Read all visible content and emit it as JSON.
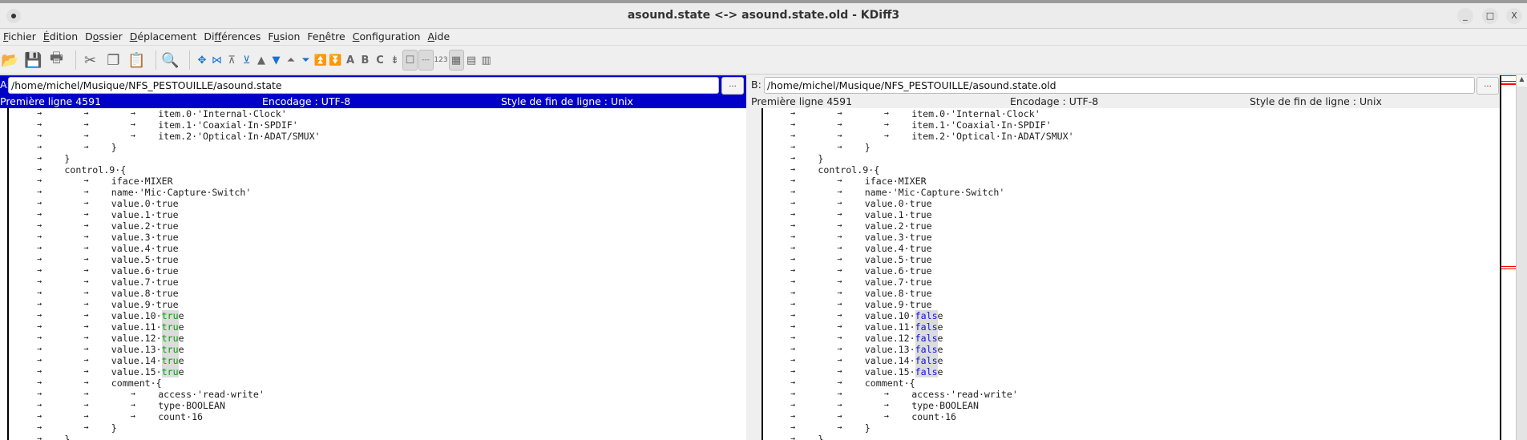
{
  "window": {
    "title": "asound.state <-> asound.state.old - KDiff3",
    "minimize": "_",
    "maximize": "□",
    "close": "X"
  },
  "menu": [
    {
      "pre": "",
      "key": "F",
      "post": "ichier"
    },
    {
      "pre": "",
      "key": "É",
      "post": "dition"
    },
    {
      "pre": "D",
      "key": "o",
      "post": "ssier"
    },
    {
      "pre": "",
      "key": "D",
      "post": "éplacement"
    },
    {
      "pre": "Di",
      "key": "f",
      "post": "férences"
    },
    {
      "pre": "F",
      "key": "u",
      "post": "sion"
    },
    {
      "pre": "Fe",
      "key": "n",
      "post": "être"
    },
    {
      "pre": "",
      "key": "C",
      "post": "onfiguration"
    },
    {
      "pre": "",
      "key": "A",
      "post": "ide"
    }
  ],
  "toolbar": [
    {
      "name": "open-icon",
      "glyph": "📂",
      "big": true
    },
    {
      "name": "save-icon",
      "glyph": "💾",
      "big": true
    },
    {
      "name": "print-icon",
      "glyph": "🖶",
      "big": true,
      "sep": true
    },
    {
      "name": "cut-icon",
      "glyph": "✂",
      "big": true
    },
    {
      "name": "copy-icon",
      "glyph": "❐",
      "big": true
    },
    {
      "name": "paste-icon",
      "glyph": "📋",
      "big": true,
      "sep": true
    },
    {
      "name": "search-icon",
      "glyph": "🔍",
      "big": true,
      "sep": true
    },
    {
      "name": "go-current-delta-icon",
      "glyph": "✥"
    },
    {
      "name": "go-current-conflict-icon",
      "glyph": "⋈"
    },
    {
      "name": "go-top-icon",
      "glyph": "⊼"
    },
    {
      "name": "go-bottom-icon",
      "glyph": "⊻"
    },
    {
      "name": "prev-delta-icon",
      "glyph": "▲"
    },
    {
      "name": "next-delta-icon",
      "glyph": "▼"
    },
    {
      "name": "prev-conflict-icon",
      "glyph": "⏶"
    },
    {
      "name": "next-conflict-icon",
      "glyph": "⏷"
    },
    {
      "name": "prev-unsolved-conflict-icon",
      "glyph": "⏫"
    },
    {
      "name": "next-unsolved-conflict-icon",
      "glyph": "⏬"
    },
    {
      "name": "select-a-icon",
      "glyph": "A"
    },
    {
      "name": "select-b-icon",
      "glyph": "B"
    },
    {
      "name": "select-c-icon",
      "glyph": "C"
    },
    {
      "name": "auto-advance-icon",
      "glyph": "⇟"
    },
    {
      "name": "show-whitespace-icon",
      "glyph": "☐",
      "on": true
    },
    {
      "name": "show-whitespace-chars-icon",
      "glyph": "---",
      "on": true
    },
    {
      "name": "line-numbers-icon",
      "glyph": "123"
    },
    {
      "name": "window-layout-icon",
      "glyph": "▦",
      "on": true
    },
    {
      "name": "window-split-icon",
      "glyph": "▤"
    },
    {
      "name": "window-split-alt-icon",
      "glyph": "▥"
    }
  ],
  "pane_a": {
    "label": "A:",
    "path": "/home/michel/Musique/NFS_PESTOUILLE/asound.state",
    "browse": "...",
    "first_line": "Première ligne 4591",
    "encoding": "Encodage : UTF-8",
    "eol": "Style de fin de ligne : Unix",
    "lines": [
      {
        "indent": 3,
        "text": "item.0·'Internal·Clock'"
      },
      {
        "indent": 3,
        "text": "item.1·'Coaxial·In·SPDIF'"
      },
      {
        "indent": 3,
        "text": "item.2·'Optical·In·ADAT/SMUX'"
      },
      {
        "indent": 2,
        "text": "}"
      },
      {
        "indent": 1,
        "text": "}"
      },
      {
        "indent": 1,
        "text": "control.9·{"
      },
      {
        "indent": 2,
        "text": "iface·MIXER"
      },
      {
        "indent": 2,
        "text": "name·'Mic·Capture·Switch'"
      },
      {
        "indent": 2,
        "text": "value.0·true"
      },
      {
        "indent": 2,
        "text": "value.1·true"
      },
      {
        "indent": 2,
        "text": "value.2·true"
      },
      {
        "indent": 2,
        "text": "value.3·true"
      },
      {
        "indent": 2,
        "text": "value.4·true"
      },
      {
        "indent": 2,
        "text": "value.5·true"
      },
      {
        "indent": 2,
        "text": "value.6·true"
      },
      {
        "indent": 2,
        "text": "value.7·true"
      },
      {
        "indent": 2,
        "text": "value.8·true"
      },
      {
        "indent": 2,
        "text": "value.9·true"
      },
      {
        "indent": 2,
        "text": "value.10·",
        "changed": "tru",
        "rest": "e"
      },
      {
        "indent": 2,
        "text": "value.11·",
        "changed": "tru",
        "rest": "e"
      },
      {
        "indent": 2,
        "text": "value.12·",
        "changed": "tru",
        "rest": "e"
      },
      {
        "indent": 2,
        "text": "value.13·",
        "changed": "tru",
        "rest": "e"
      },
      {
        "indent": 2,
        "text": "value.14·",
        "changed": "tru",
        "rest": "e"
      },
      {
        "indent": 2,
        "text": "value.15·",
        "changed": "tru",
        "rest": "e"
      },
      {
        "indent": 2,
        "text": "comment·{"
      },
      {
        "indent": 3,
        "text": "access·'read·write'"
      },
      {
        "indent": 3,
        "text": "type·BOOLEAN"
      },
      {
        "indent": 3,
        "text": "count·16"
      },
      {
        "indent": 2,
        "text": "}"
      },
      {
        "indent": 1,
        "text": "}"
      }
    ]
  },
  "pane_b": {
    "label": "B:",
    "path": "/home/michel/Musique/NFS_PESTOUILLE/asound.state.old",
    "browse": "...",
    "first_line": "Première ligne 4591",
    "encoding": "Encodage : UTF-8",
    "eol": "Style de fin de ligne : Unix",
    "lines": [
      {
        "indent": 3,
        "text": "item.0·'Internal·Clock'"
      },
      {
        "indent": 3,
        "text": "item.1·'Coaxial·In·SPDIF'"
      },
      {
        "indent": 3,
        "text": "item.2·'Optical·In·ADAT/SMUX'"
      },
      {
        "indent": 2,
        "text": "}"
      },
      {
        "indent": 1,
        "text": "}"
      },
      {
        "indent": 1,
        "text": "control.9·{"
      },
      {
        "indent": 2,
        "text": "iface·MIXER"
      },
      {
        "indent": 2,
        "text": "name·'Mic·Capture·Switch'"
      },
      {
        "indent": 2,
        "text": "value.0·true"
      },
      {
        "indent": 2,
        "text": "value.1·true"
      },
      {
        "indent": 2,
        "text": "value.2·true"
      },
      {
        "indent": 2,
        "text": "value.3·true"
      },
      {
        "indent": 2,
        "text": "value.4·true"
      },
      {
        "indent": 2,
        "text": "value.5·true"
      },
      {
        "indent": 2,
        "text": "value.6·true"
      },
      {
        "indent": 2,
        "text": "value.7·true"
      },
      {
        "indent": 2,
        "text": "value.8·true"
      },
      {
        "indent": 2,
        "text": "value.9·true"
      },
      {
        "indent": 2,
        "text": "value.10·",
        "changed": "fals",
        "rest": "e"
      },
      {
        "indent": 2,
        "text": "value.11·",
        "changed": "fals",
        "rest": "e"
      },
      {
        "indent": 2,
        "text": "value.12·",
        "changed": "fals",
        "rest": "e"
      },
      {
        "indent": 2,
        "text": "value.13·",
        "changed": "fals",
        "rest": "e"
      },
      {
        "indent": 2,
        "text": "value.14·",
        "changed": "fals",
        "rest": "e"
      },
      {
        "indent": 2,
        "text": "value.15·",
        "changed": "fals",
        "rest": "e"
      },
      {
        "indent": 2,
        "text": "comment·{"
      },
      {
        "indent": 3,
        "text": "access·'read·write'"
      },
      {
        "indent": 3,
        "text": "type·BOOLEAN"
      },
      {
        "indent": 3,
        "text": "count·16"
      },
      {
        "indent": 2,
        "text": "}"
      },
      {
        "indent": 1,
        "text": "}"
      }
    ]
  },
  "tab_glyph": "→",
  "colors": {
    "active_pane": "#0000c8",
    "diff_a": "#0a9a0a",
    "diff_b": "#1515d8",
    "overview_marker": "#ff0000"
  }
}
